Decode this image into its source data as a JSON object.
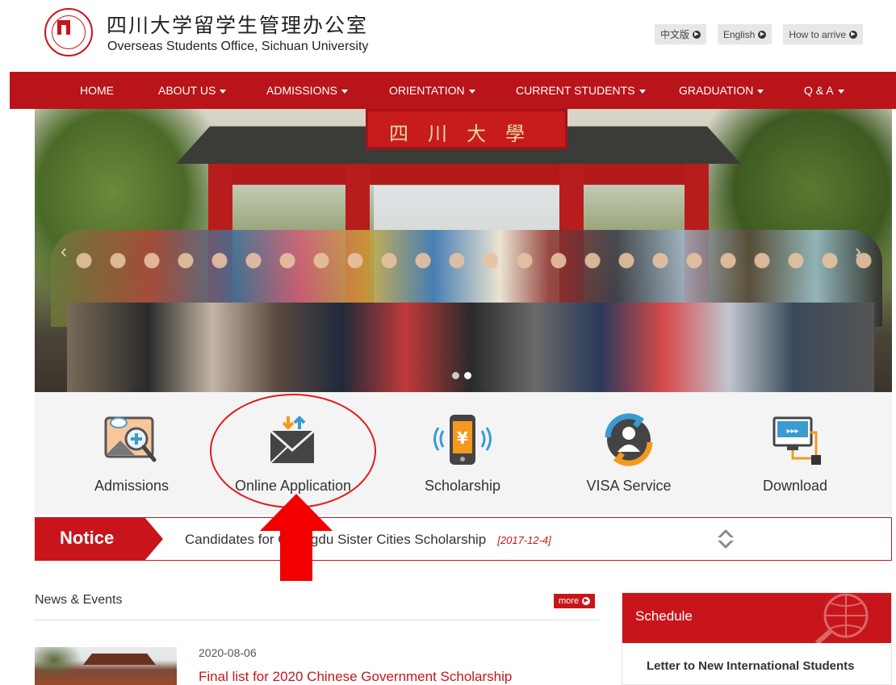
{
  "header": {
    "logo_cn": "四川大学留学生管理办公室",
    "logo_en": "Overseas Students Office, Sichuan University",
    "top_links": [
      {
        "label": "中文版"
      },
      {
        "label": "English"
      },
      {
        "label": "How to arrive"
      }
    ]
  },
  "nav": {
    "items": [
      {
        "label": "HOME",
        "has_dropdown": false
      },
      {
        "label": "ABOUT US",
        "has_dropdown": true
      },
      {
        "label": "ADMISSIONS",
        "has_dropdown": true
      },
      {
        "label": "ORIENTATION",
        "has_dropdown": true
      },
      {
        "label": "CURRENT STUDENTS",
        "has_dropdown": true
      },
      {
        "label": "GRADUATION",
        "has_dropdown": true
      },
      {
        "label": "Q & A",
        "has_dropdown": true
      }
    ]
  },
  "banner": {
    "gate_plaque_text": "四川大學",
    "slide_count": 2,
    "active_slide": 2
  },
  "quick_links": [
    {
      "label": "Admissions",
      "icon": "admissions-search-icon"
    },
    {
      "label": "Online Application",
      "icon": "mail-upload-icon"
    },
    {
      "label": "Scholarship",
      "icon": "phone-yuan-icon"
    },
    {
      "label": "VISA Service",
      "icon": "visa-person-icon"
    },
    {
      "label": "Download",
      "icon": "download-monitor-icon"
    }
  ],
  "notice": {
    "tag": "Notice",
    "text": "Candidates for Chengdu Sister Cities Scholarship",
    "date": "[2017-12-4]"
  },
  "news": {
    "section_title": "News & Events",
    "more_label": "more",
    "items": [
      {
        "date": "2020-08-06",
        "headline": "Final list for 2020 Chinese Government Scholarship"
      }
    ]
  },
  "schedule": {
    "title": "Schedule",
    "items": [
      "Letter to New International Students"
    ]
  },
  "colors": {
    "brand_red": "#b8141a",
    "accent_red": "#c8151b",
    "annotation_red": "#e21a1a"
  }
}
